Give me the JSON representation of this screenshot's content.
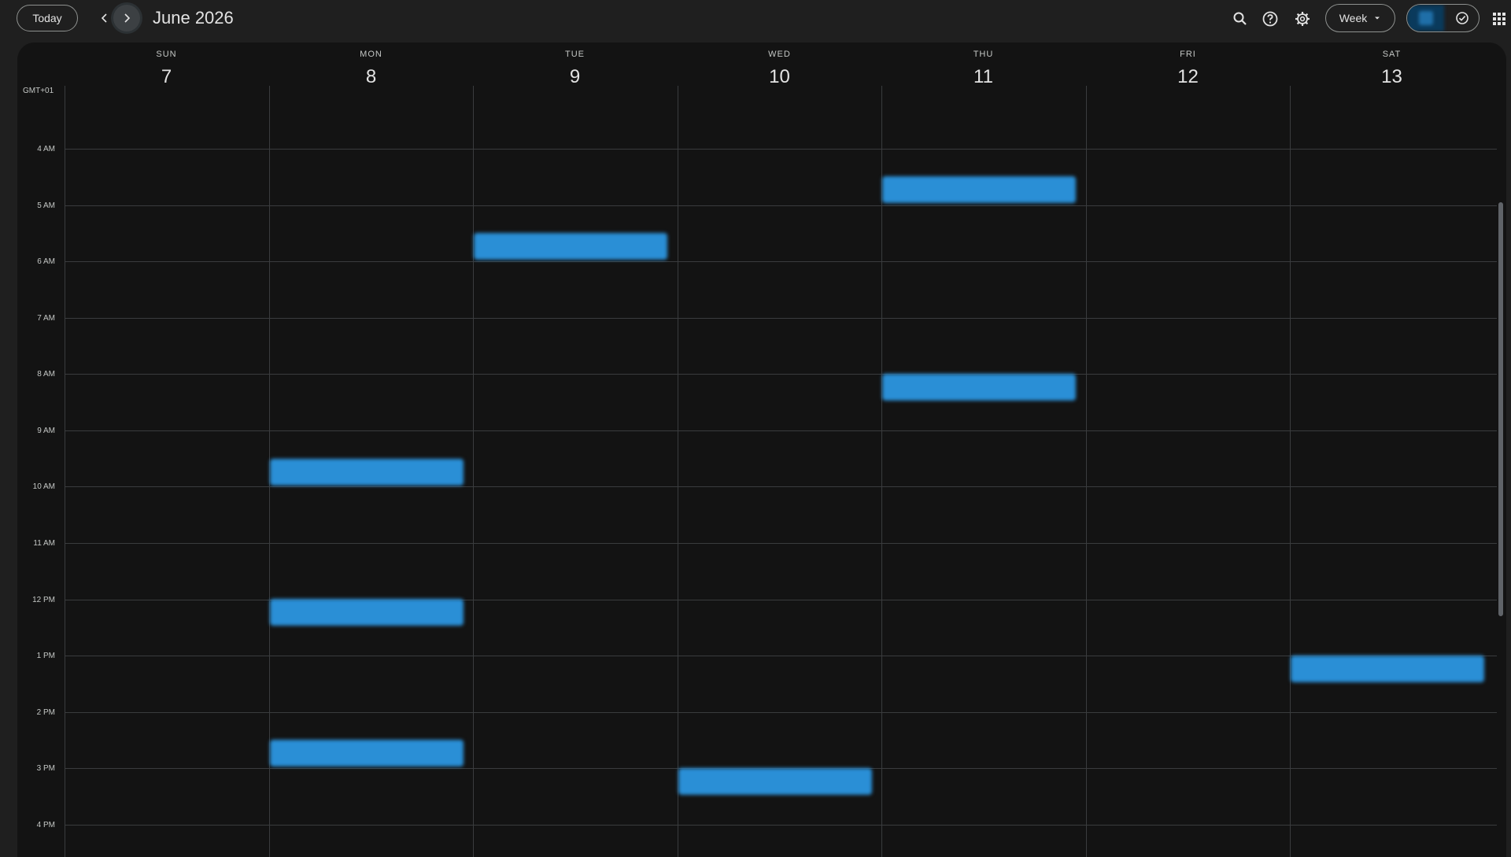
{
  "toolbar": {
    "today_label": "Today",
    "title": "June 2026",
    "view_label": "Week"
  },
  "icons": {
    "prev": "chevron-left-icon",
    "next": "chevron-right-icon",
    "search": "search-icon",
    "help": "help-icon",
    "settings": "gear-icon",
    "view_dropdown": "caret-down-icon",
    "tasks": "check-circle-icon",
    "apps": "apps-grid-icon"
  },
  "calendar": {
    "timezone": "GMT+01",
    "days": [
      {
        "name": "SUN",
        "num": "7"
      },
      {
        "name": "MON",
        "num": "8"
      },
      {
        "name": "TUE",
        "num": "9"
      },
      {
        "name": "WED",
        "num": "10"
      },
      {
        "name": "THU",
        "num": "11"
      },
      {
        "name": "FRI",
        "num": "12"
      },
      {
        "name": "SAT",
        "num": "13"
      }
    ],
    "hours": [
      "4 AM",
      "5 AM",
      "6 AM",
      "7 AM",
      "8 AM",
      "9 AM",
      "10 AM",
      "11 AM",
      "12 PM",
      "1 PM",
      "2 PM",
      "3 PM",
      "4 PM"
    ]
  },
  "colors": {
    "event": "#2a8fd6",
    "background": "#131313",
    "surface": "#1f1f1f"
  }
}
